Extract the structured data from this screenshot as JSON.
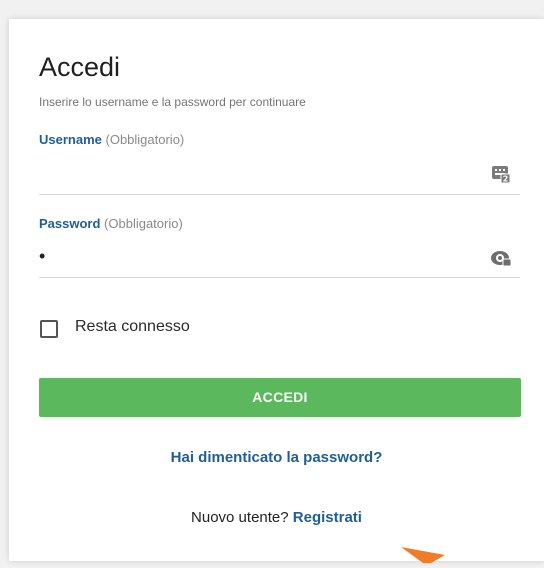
{
  "login": {
    "title": "Accedi",
    "subtitle": "Inserire lo username e la password per continuare",
    "username": {
      "label": "Username",
      "required": "(Obbligatorio)",
      "value": ""
    },
    "password": {
      "label": "Password",
      "required": "(Obbligatorio)",
      "value": "•"
    },
    "remember": {
      "label": "Resta connesso",
      "checked": false
    },
    "submit_label": "ACCEDI",
    "forgot_label": "Hai dimenticato la password?",
    "register_prompt": "Nuovo utente?",
    "register_link": "Registrati"
  },
  "icons": {
    "username_field": "keyboard-icon",
    "password_field": "eye-icon",
    "pointer": "arrow-cursor-icon"
  },
  "colors": {
    "accent": "#1f5f96",
    "button": "#5cb85c",
    "pointer": "#f07c27"
  }
}
